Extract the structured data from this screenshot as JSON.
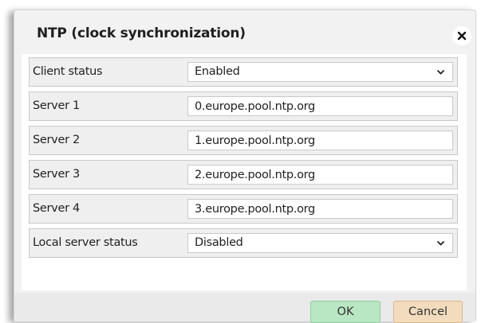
{
  "dialog": {
    "title": "NTP (clock synchronization)",
    "close_icon": "close-icon"
  },
  "fields": {
    "client_status": {
      "label": "Client status",
      "value": "Enabled",
      "icon": "chevron-down-icon"
    },
    "server1": {
      "label": "Server 1",
      "value": "0.europe.pool.ntp.org"
    },
    "server2": {
      "label": "Server 2",
      "value": "1.europe.pool.ntp.org"
    },
    "server3": {
      "label": "Server 3",
      "value": "2.europe.pool.ntp.org"
    },
    "server4": {
      "label": "Server 4",
      "value": "3.europe.pool.ntp.org"
    },
    "local_server_status": {
      "label": "Local server status",
      "value": "Disabled",
      "icon": "chevron-down-icon"
    }
  },
  "footer": {
    "ok_label": "OK",
    "cancel_label": "Cancel"
  },
  "colors": {
    "ok_button": "#b9e6c3",
    "cancel_button": "#f3dcbd",
    "row_background": "#efefef",
    "dialog_background": "#f2f2f2"
  }
}
